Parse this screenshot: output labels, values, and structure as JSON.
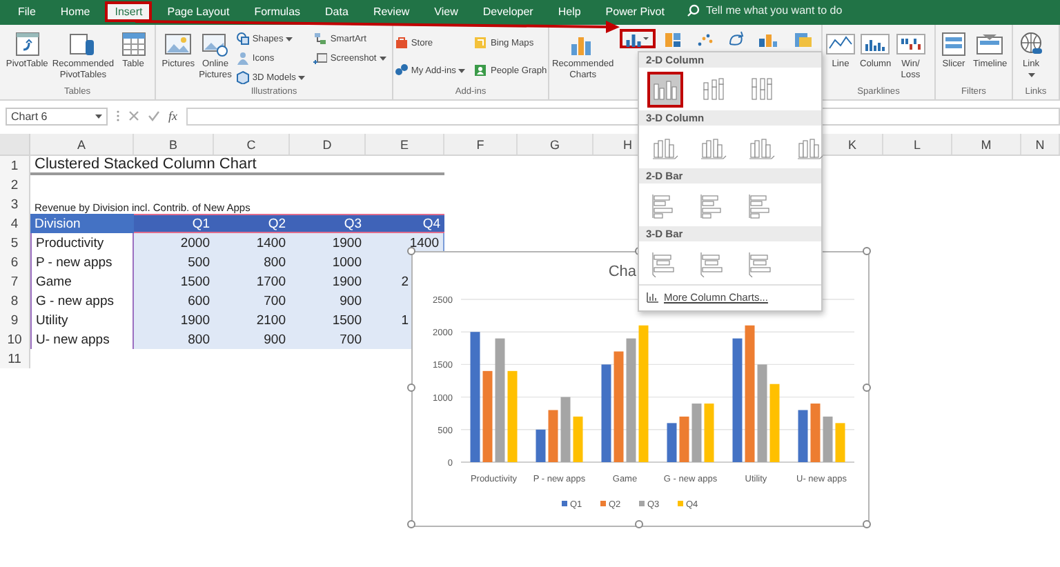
{
  "ribbon_tabs": [
    {
      "label": "File",
      "selected": false
    },
    {
      "label": "Home",
      "selected": false
    },
    {
      "label": "Insert",
      "selected": true
    },
    {
      "label": "Page Layout",
      "selected": false
    },
    {
      "label": "Formulas",
      "selected": false
    },
    {
      "label": "Data",
      "selected": false
    },
    {
      "label": "Review",
      "selected": false
    },
    {
      "label": "View",
      "selected": false
    },
    {
      "label": "Developer",
      "selected": false
    },
    {
      "label": "Help",
      "selected": false
    },
    {
      "label": "Power Pivot",
      "selected": false
    }
  ],
  "search": {
    "placeholder": "Tell me what you want to do"
  },
  "ribbon_groups": [
    {
      "label": "Tables",
      "buttons": [
        {
          "label": "PivotTable",
          "kind": "large",
          "menu": false
        },
        {
          "label": "Recommended PivotTables",
          "kind": "large",
          "menu": false
        },
        {
          "label": "Table",
          "kind": "large",
          "menu": false
        }
      ]
    },
    {
      "label": "Illustrations",
      "buttons": [
        {
          "label": "Pictures",
          "kind": "large",
          "menu": false
        },
        {
          "label": "Online Pictures",
          "kind": "large",
          "menu": false
        },
        {
          "label": "Shapes",
          "kind": "small",
          "menu": true
        },
        {
          "label": "Icons",
          "kind": "small",
          "menu": false
        },
        {
          "label": "3D Models",
          "kind": "small",
          "menu": true
        },
        {
          "label": "SmartArt",
          "kind": "small",
          "menu": false
        },
        {
          "label": "Screenshot",
          "kind": "small",
          "menu": true
        }
      ]
    },
    {
      "label": "Add-ins",
      "buttons": [
        {
          "label": "Store",
          "kind": "small",
          "menu": false
        },
        {
          "label": "My Add-ins",
          "kind": "small",
          "menu": true
        },
        {
          "label": "Bing Maps",
          "kind": "small",
          "menu": false
        },
        {
          "label": "People Graph",
          "kind": "small",
          "menu": false
        }
      ]
    },
    {
      "buttons": [
        {
          "label": "Recommended Charts",
          "kind": "large",
          "menu": false
        },
        {
          "kind": "gallery",
          "items": [
            {
              "highlighted": true
            },
            {
              "highlighted": false
            },
            {
              "highlighted": false
            },
            {
              "highlighted": false
            },
            {
              "highlighted": false
            },
            {
              "highlighted": false
            }
          ]
        }
      ]
    },
    {
      "label": "Sparklines",
      "buttons": [
        {
          "label": "Line",
          "kind": "large",
          "menu": false
        },
        {
          "label": "Column",
          "kind": "large",
          "menu": false
        },
        {
          "label": "Win/ Loss",
          "kind": "large",
          "menu": false
        }
      ]
    },
    {
      "label": "Filters",
      "buttons": [
        {
          "label": "Slicer",
          "kind": "large",
          "menu": false
        },
        {
          "label": "Timeline",
          "kind": "large",
          "menu": false
        }
      ]
    },
    {
      "label": "Links",
      "buttons": [
        {
          "label": "Link",
          "kind": "large",
          "menu": true
        }
      ]
    }
  ],
  "formula_bar": {
    "name_box": "Chart 6",
    "function_label": "fx"
  },
  "sheet": {
    "columns": [
      "A",
      "B",
      "C",
      "D",
      "E",
      "F",
      "G",
      "H",
      "K",
      "L",
      "M",
      "N"
    ],
    "rows": [
      {
        "number": "1",
        "kind": "title",
        "text": "Clustered Stacked Column Chart"
      },
      {
        "number": "2",
        "kind": "blank"
      },
      {
        "number": "3",
        "kind": "note",
        "text": "Revenue by Division incl. Contrib. of New Apps"
      },
      {
        "number": "4",
        "kind": "header",
        "cells": [
          "Division",
          "Q1",
          "Q2",
          "Q3",
          "Q4"
        ]
      },
      {
        "number": "5",
        "kind": "data",
        "cells": [
          "Productivity",
          "2000",
          "1400",
          "1900",
          "1400"
        ]
      },
      {
        "number": "6",
        "kind": "data",
        "cells": [
          "P - new apps",
          "500",
          "800",
          "1000"
        ]
      },
      {
        "number": "7",
        "kind": "data",
        "cells": [
          "Game",
          "1500",
          "1700",
          "1900",
          "2"
        ]
      },
      {
        "number": "8",
        "kind": "data",
        "cells": [
          "G - new apps",
          "600",
          "700",
          "900"
        ]
      },
      {
        "number": "9",
        "kind": "data",
        "cells": [
          "Utility",
          "1900",
          "2100",
          "1500",
          "1"
        ]
      },
      {
        "number": "10",
        "kind": "data",
        "cells": [
          "U- new apps",
          "800",
          "900",
          "700"
        ]
      },
      {
        "number": "11",
        "kind": "blank"
      }
    ]
  },
  "chart": {
    "chart_data": {
      "type": "bar",
      "title": "Cha",
      "categories": [
        "Productivity",
        "P - new apps",
        "Game",
        "G - new apps",
        "Utility",
        "U- new apps"
      ],
      "series": [
        {
          "name": "Q1",
          "color": "#4472c4",
          "values": [
            2000,
            500,
            1500,
            600,
            1900,
            800
          ]
        },
        {
          "name": "Q2",
          "color": "#ed7d31",
          "values": [
            1400,
            800,
            1700,
            700,
            2100,
            900
          ]
        },
        {
          "name": "Q3",
          "color": "#a5a5a5",
          "values": [
            1900,
            1000,
            1900,
            900,
            1500,
            700
          ]
        },
        {
          "name": "Q4",
          "color": "#ffc000",
          "values": [
            1400,
            700,
            2100,
            900,
            1200,
            600
          ]
        }
      ],
      "ylim": [
        0,
        2500
      ],
      "yticks": [
        {
          "value": 0,
          "label": "0"
        },
        {
          "value": 500,
          "label": "500"
        },
        {
          "value": 1000,
          "label": "1000"
        },
        {
          "value": 1500,
          "label": "1500"
        },
        {
          "value": 2000,
          "label": "2000"
        },
        {
          "value": 2500,
          "label": "2500"
        }
      ],
      "grid": true,
      "legend": true
    }
  },
  "chart_menu": {
    "sections": [
      {
        "label": "2-D Column",
        "kind": "column2d",
        "options": [
          {
            "selected": true
          },
          {
            "selected": false
          },
          {
            "selected": false
          }
        ]
      },
      {
        "label": "3-D Column",
        "kind": "column3d",
        "options": [
          {
            "selected": false
          },
          {
            "selected": false
          },
          {
            "selected": false
          },
          {
            "selected": false
          }
        ]
      },
      {
        "label": "2-D Bar",
        "kind": "bar2d",
        "options": [
          {
            "selected": false
          },
          {
            "selected": false
          },
          {
            "selected": false
          }
        ]
      },
      {
        "label": "3-D Bar",
        "kind": "bar3d",
        "options": [
          {
            "selected": false
          },
          {
            "selected": false
          },
          {
            "selected": false
          }
        ]
      }
    ],
    "footer": "More Column Charts..."
  }
}
